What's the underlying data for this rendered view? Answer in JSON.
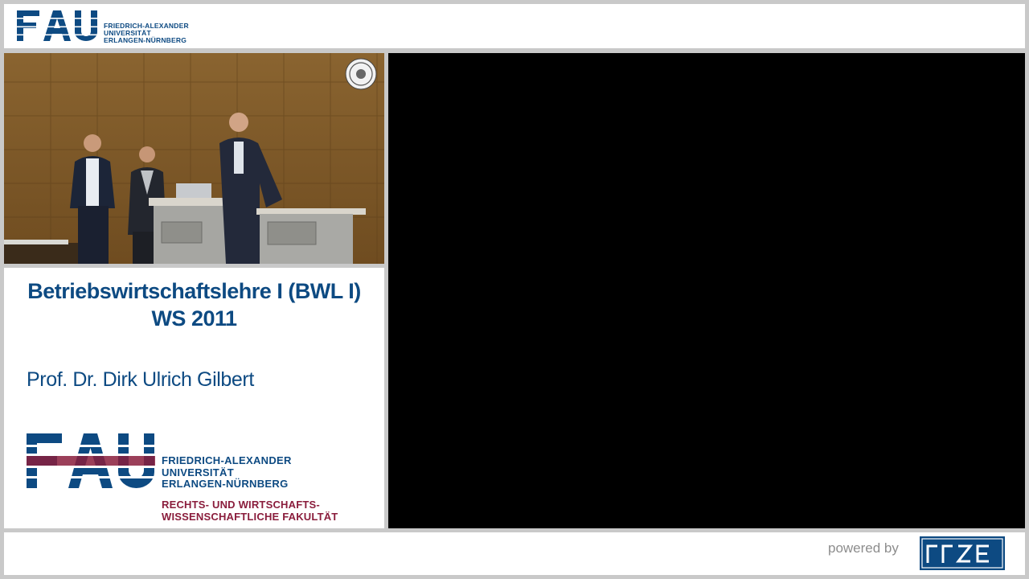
{
  "header": {
    "logo_text": "FAU",
    "university_lines": [
      "FRIEDRICH-ALEXANDER",
      "UNIVERSITÄT",
      "ERLANGEN-NÜRNBERG"
    ]
  },
  "info": {
    "course_title": "Betriebswirtschaftslehre I (BWL I)",
    "course_term": "WS 2011",
    "professor": "Prof. Dr. Dirk Ulrich Gilbert",
    "university_lines": [
      "FRIEDRICH-ALEXANDER",
      "UNIVERSITÄT",
      "ERLANGEN-NÜRNBERG"
    ],
    "faculty_lines": [
      "RECHTS- UND WIRTSCHAFTS-",
      "WISSENSCHAFTLICHE FAKULTÄT"
    ]
  },
  "footer": {
    "powered_by": "powered by",
    "partner_logo": "rrze"
  },
  "colors": {
    "fau_blue": "#0d4a82",
    "fau_red": "#8a1d3c",
    "slide_background": "#000000",
    "frame": "#c9c9c9"
  },
  "icons": {
    "seal": "university-seal-icon"
  }
}
